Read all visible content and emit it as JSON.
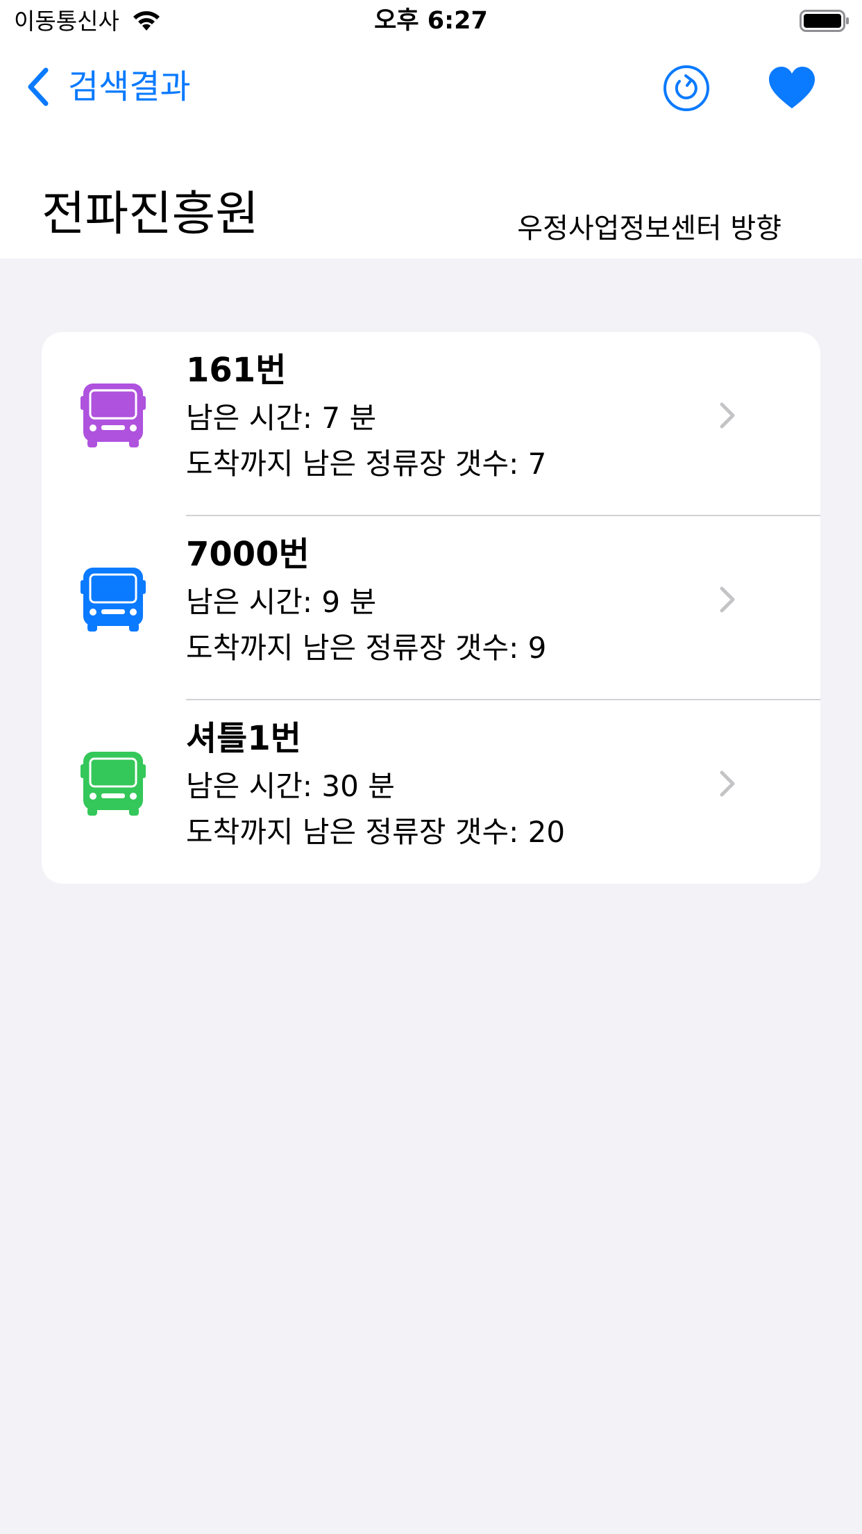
{
  "status_bar": {
    "carrier": "이동통신사",
    "time": "오후 6:27",
    "icons": [
      "wifi-icon",
      "battery-icon"
    ]
  },
  "nav": {
    "back_label": "검색결과",
    "actions": [
      "refresh-icon",
      "heart-icon"
    ],
    "accent_color": "#0a7aff"
  },
  "header": {
    "stop_name": "전파진흥원",
    "direction": "우정사업정보센터 방향"
  },
  "arrivals": [
    {
      "route": "161번",
      "time": "남은 시간: 7 분",
      "stops": "도착까지 남은 정류장 갯수: 7",
      "icon": "bus-icon",
      "color": "#af52de"
    },
    {
      "route": "7000번",
      "time": "남은 시간: 9 분",
      "stops": "도착까지 남은 정류장 갯수: 9",
      "icon": "bus-icon",
      "color": "#0a7aff"
    },
    {
      "route": "셔틀1번",
      "time": "남은 시간: 30 분",
      "stops": "도착까지 남은 정류장 갯수: 20",
      "icon": "bus-icon",
      "color": "#34c759"
    }
  ]
}
